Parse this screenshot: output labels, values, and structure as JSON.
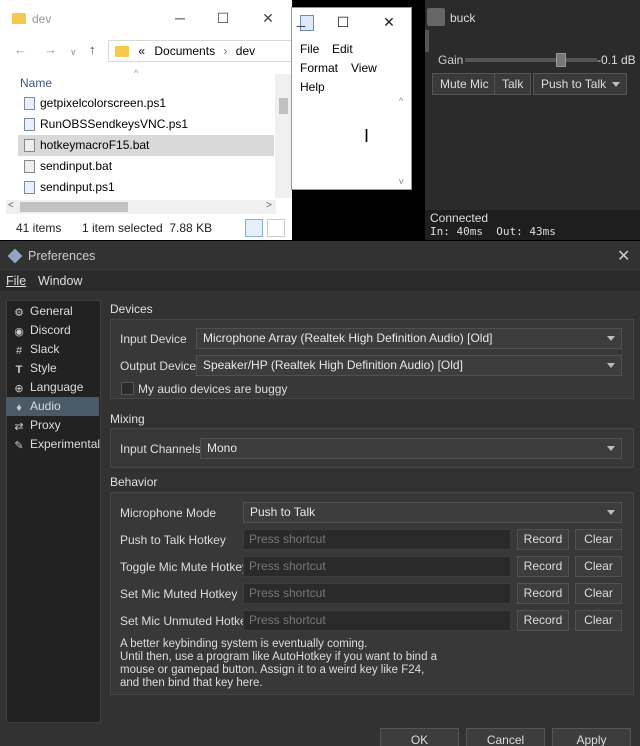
{
  "explorer": {
    "title": "dev",
    "breadcrumb": [
      "«",
      "Documents",
      "›",
      "dev"
    ],
    "column_header": "Name",
    "files": [
      "getpixelcolorscreen.ps1",
      "RunOBSSendkeysVNC.ps1",
      "hotkeymacroF15.bat",
      "sendinput.bat",
      "sendinput.ps1"
    ],
    "selected_file": "hotkeymacroF15.bat",
    "status_items": "41 items",
    "status_selected": "1 item selected  7.88 KB"
  },
  "notepad": {
    "menu": [
      "File",
      "Edit",
      "Format",
      "View",
      "Help"
    ]
  },
  "voice": {
    "user_name": "buck",
    "gain_label": "Gain",
    "gain_value": "-0.1 dB",
    "gain_level": 0.73,
    "mute_label": "Mute Mic",
    "talk_label": "Talk",
    "mode_label": "Push to Talk",
    "status": "Connected",
    "latency": "In: 40ms  Out: 43ms"
  },
  "prefs": {
    "title": "Preferences",
    "menu": [
      "File",
      "Window"
    ],
    "sidebar": [
      {
        "label": "General",
        "icon": "gear-icon"
      },
      {
        "label": "Discord",
        "icon": "discord-icon"
      },
      {
        "label": "Slack",
        "icon": "slack-icon"
      },
      {
        "label": "Style",
        "icon": "text-style-icon"
      },
      {
        "label": "Language",
        "icon": "globe-icon"
      },
      {
        "label": "Audio",
        "icon": "microphone-icon",
        "active": true
      },
      {
        "label": "Proxy",
        "icon": "proxy-icon"
      },
      {
        "label": "Experimental",
        "icon": "wrench-icon"
      }
    ],
    "devices": {
      "section": "Devices",
      "input_label": "Input Device",
      "input_value": "Microphone Array (Realtek High Definition Audio) [Old]",
      "output_label": "Output Device",
      "output_value": "Speaker/HP (Realtek High Definition Audio) [Old]",
      "buggy_label": "My audio devices are buggy"
    },
    "mixing": {
      "section": "Mixing",
      "channels_label": "Input Channels",
      "channels_value": "Mono"
    },
    "behavior": {
      "section": "Behavior",
      "mode_label": "Microphone Mode",
      "mode_value": "Push to Talk",
      "placeholder": "Press shortcut",
      "record_label": "Record",
      "clear_label": "Clear",
      "hotkeys": [
        "Push to Talk Hotkey",
        "Toggle Mic Mute Hotkey",
        "Set Mic Muted Hotkey",
        "Set Mic Unmuted Hotkey"
      ],
      "note_lines": [
        "A better keybinding system is eventually coming.",
        "Until then, use a program like AutoHotkey if you want to bind a",
        "mouse or gamepad button. Assign it to a weird key like F24,",
        "and then bind that key here."
      ]
    },
    "buttons": {
      "ok": "OK",
      "cancel": "Cancel",
      "apply": "Apply"
    }
  }
}
